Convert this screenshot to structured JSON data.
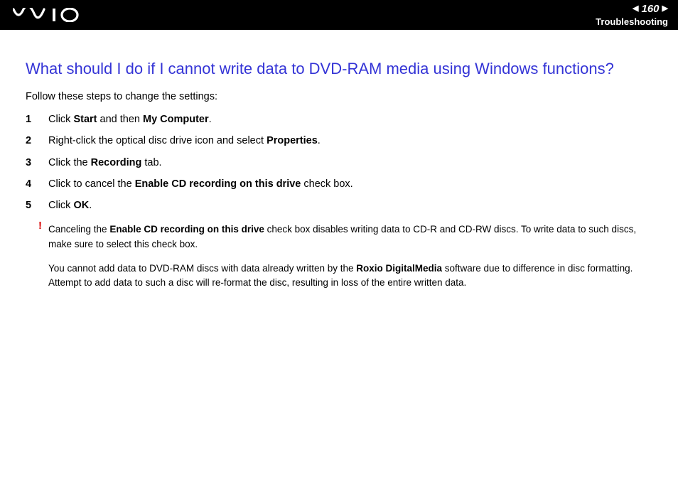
{
  "header": {
    "page_number": "160",
    "section": "Troubleshooting"
  },
  "title": "What should I do if I cannot write data to DVD-RAM media using Windows functions?",
  "intro": "Follow these steps to change the settings:",
  "steps": [
    {
      "num": "1",
      "t1": "Click ",
      "b1": "Start",
      "t2": " and then ",
      "b2": "My Computer",
      "t3": "."
    },
    {
      "num": "2",
      "t1": "Right-click the optical disc drive icon and select ",
      "b1": "Properties",
      "t2": ".",
      "b2": "",
      "t3": ""
    },
    {
      "num": "3",
      "t1": "Click the ",
      "b1": "Recording",
      "t2": " tab.",
      "b2": "",
      "t3": ""
    },
    {
      "num": "4",
      "t1": "Click to cancel the ",
      "b1": "Enable CD recording on this drive",
      "t2": " check box.",
      "b2": "",
      "t3": ""
    },
    {
      "num": "5",
      "t1": "Click ",
      "b1": "OK",
      "t2": ".",
      "b2": "",
      "t3": ""
    }
  ],
  "warning": {
    "mark": "!",
    "p1_a": "Canceling the ",
    "p1_b": "Enable CD recording on this drive",
    "p1_c": " check box disables writing data to CD-R and CD-RW discs. To write data to such discs, make sure to select this check box.",
    "p2_a": "You cannot add data to DVD-RAM discs with data already written by the ",
    "p2_b": "Roxio DigitalMedia",
    "p2_c": " software due to difference in disc formatting. Attempt to add data to such a disc will re-format the disc, resulting in loss of the entire written data."
  }
}
